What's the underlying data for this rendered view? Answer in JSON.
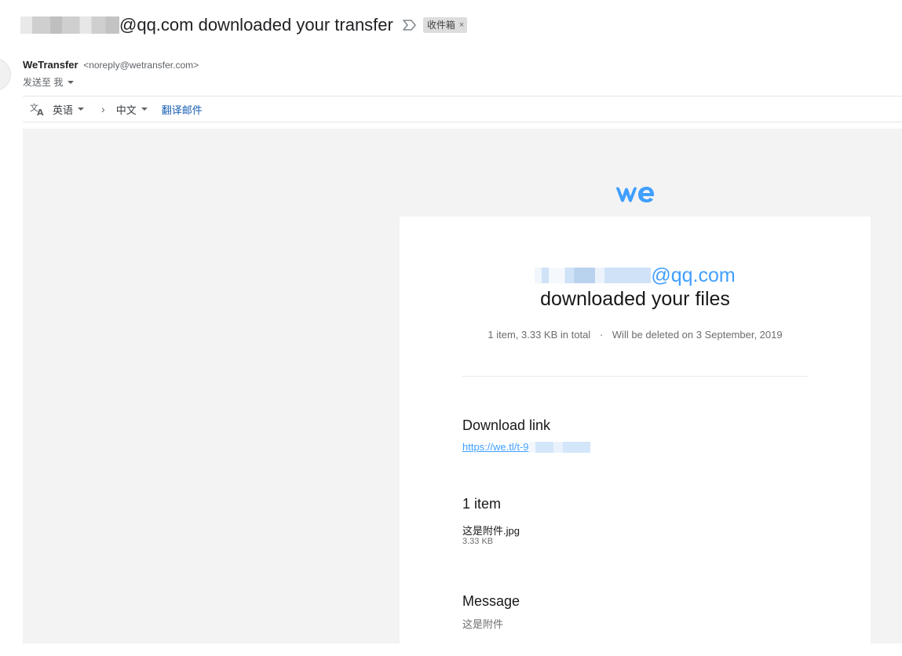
{
  "subject": {
    "text": "@qq.com downloaded your transfer",
    "label": "收件箱",
    "label_remove": "×"
  },
  "sender": {
    "name": "WeTransfer",
    "email": "<noreply@wetransfer.com>",
    "to": "发送至 我"
  },
  "translate": {
    "from_lang": "英语",
    "arrow": "›",
    "to_lang": "中文",
    "action": "翻译邮件"
  },
  "email": {
    "logo_icon": "wetransfer-logo",
    "recipient_suffix": "@qq.com",
    "headline": "downloaded your files",
    "meta_items": "1 item, 3.33 KB in total",
    "meta_dot": "·",
    "meta_deleted": "Will be deleted on 3 September, 2019",
    "download_title": "Download link",
    "download_link": "https://we.tl/t-9",
    "items_title": "1 item",
    "file_name": "这是附件.jpg",
    "file_size": "3.33 KB",
    "message_title": "Message",
    "message_text": "这是附件"
  },
  "colors": {
    "accent_blue": "#409fff",
    "translate_link": "#1a5fb4",
    "body_bg": "#f3f3f3"
  }
}
